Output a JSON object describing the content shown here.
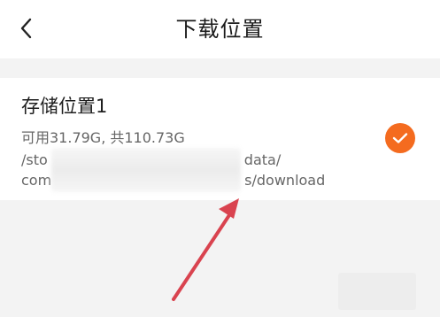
{
  "header": {
    "title": "下载位置",
    "back_icon": "chevron-left-icon"
  },
  "storage": {
    "name": "存储位置1",
    "capacity": "可用31.79G, 共110.73G",
    "path_line1_start": "/sto",
    "path_line1_end": "data/",
    "path_line2_start": "com",
    "path_line2_end": "s/download",
    "selected_icon": "check-icon"
  },
  "colors": {
    "accent": "#f46b1f",
    "annotation_arrow": "#d9434f"
  }
}
